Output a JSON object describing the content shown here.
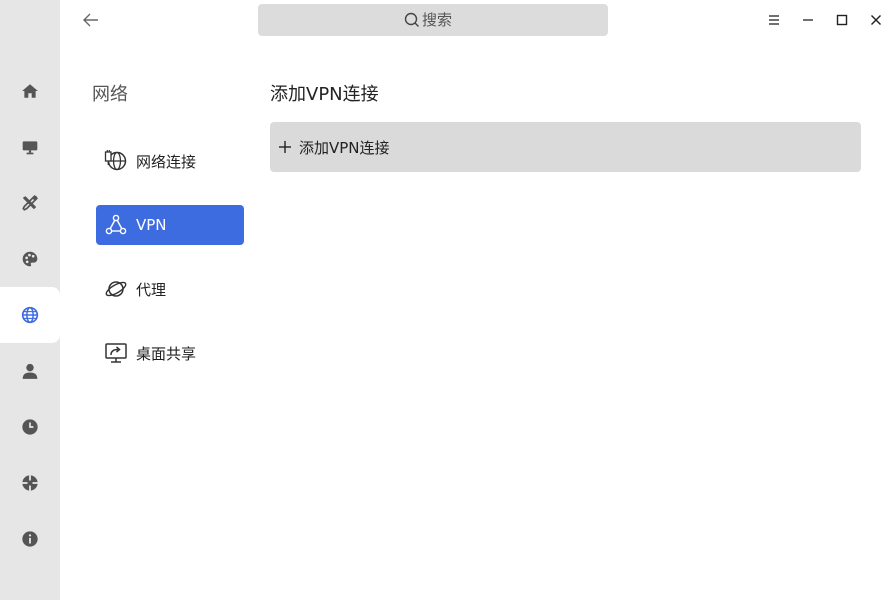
{
  "search": {
    "placeholder": "搜索"
  },
  "rail": {
    "items": [
      {
        "icon": "home-icon"
      },
      {
        "icon": "monitor-icon"
      },
      {
        "icon": "tools-icon"
      },
      {
        "icon": "palette-icon"
      },
      {
        "icon": "globe-icon",
        "active": true
      },
      {
        "icon": "user-icon"
      },
      {
        "icon": "clock-icon"
      },
      {
        "icon": "update-icon"
      },
      {
        "icon": "info-icon"
      }
    ]
  },
  "section": {
    "title": "网络"
  },
  "nav": {
    "items": [
      {
        "label": "网络连接",
        "icon": "network-connection-icon"
      },
      {
        "label": "VPN",
        "icon": "vpn-icon",
        "active": true
      },
      {
        "label": "代理",
        "icon": "proxy-planet-icon"
      },
      {
        "label": "桌面共享",
        "icon": "desktop-share-icon"
      }
    ]
  },
  "content": {
    "title": "添加VPN连接",
    "add_button_label": "添加VPN连接"
  },
  "colors": {
    "accent": "#3d6be0",
    "rail_bg": "#e6e6e6",
    "button_bg": "#dadada",
    "search_bg": "#dcdcdc"
  }
}
